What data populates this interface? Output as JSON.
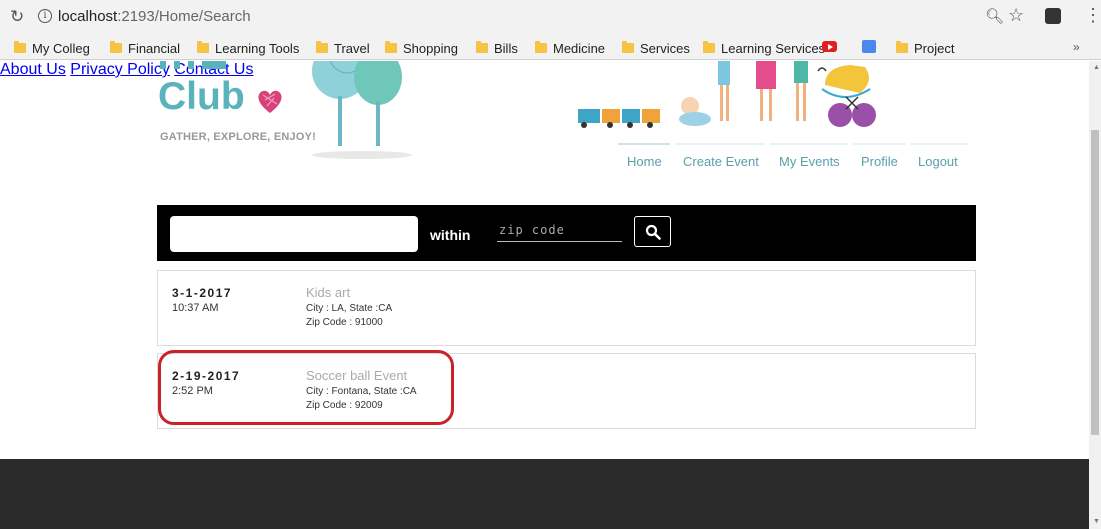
{
  "browser": {
    "url_host": "localhost",
    "url_path": ":2193/Home/Search",
    "bookmarks": [
      {
        "label": "My Colleg"
      },
      {
        "label": "Financial"
      },
      {
        "label": "Learning Tools"
      },
      {
        "label": "Travel"
      },
      {
        "label": "Shopping"
      },
      {
        "label": "Bills"
      },
      {
        "label": "Medicine"
      },
      {
        "label": "Services"
      },
      {
        "label": "Learning Services"
      },
      {
        "label": "Project"
      }
    ],
    "more": "»"
  },
  "header": {
    "logo_word": "Club",
    "tagline": "GATHER, EXPLORE, ENJOY!"
  },
  "nav": [
    {
      "label": "Home"
    },
    {
      "label": "Create Event"
    },
    {
      "label": "My Events"
    },
    {
      "label": "Profile"
    },
    {
      "label": "Logout"
    }
  ],
  "search": {
    "query": "",
    "within_label": "within",
    "zip_placeholder": "zip code"
  },
  "events": [
    {
      "date": "3-1-2017",
      "time": "10:37 AM",
      "title": "Kids art",
      "city_line": "City : LA, State :CA",
      "zip_line": "Zip Code : 91000"
    },
    {
      "date": "2-19-2017",
      "time": "2:52 PM",
      "title": "Soccer ball Event",
      "city_line": "City : Fontana, State :CA",
      "zip_line": "Zip Code : 92009"
    }
  ],
  "footer": {
    "links": [
      {
        "label": "About Us"
      },
      {
        "label": "Privacy Policy"
      },
      {
        "label": "Contact Us"
      }
    ]
  },
  "colors": {
    "brand_teal": "#5ab2bd",
    "highlight_red": "#c9222b",
    "footer_link": "#e8b84a",
    "footer_bg": "#2b2b2b"
  }
}
